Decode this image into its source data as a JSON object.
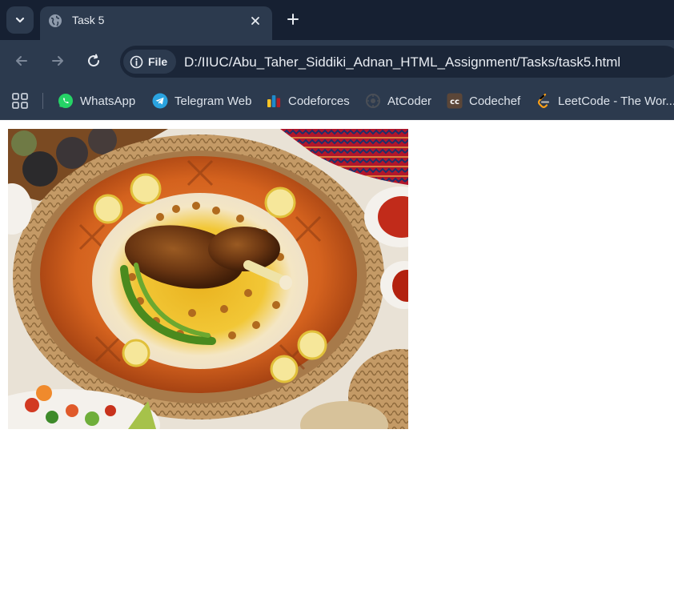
{
  "browser": {
    "tab": {
      "title": "Task 5",
      "favicon": "globe-icon"
    },
    "address_bar": {
      "chip_label": "File",
      "url": "D:/IIUC/Abu_Taher_Siddiki_Adnan_HTML_Assignment/Tasks/task5.html"
    },
    "bookmarks": [
      {
        "label": "WhatsApp",
        "icon": "whatsapp-icon",
        "color": "#25D366"
      },
      {
        "label": "Telegram Web",
        "icon": "telegram-icon",
        "color": "#2AA3E0"
      },
      {
        "label": "Codeforces",
        "icon": "codeforces-icon",
        "color": "#1F8ACB"
      },
      {
        "label": "AtCoder",
        "icon": "atcoder-icon",
        "color": "#3a3a3a"
      },
      {
        "label": "Codechef",
        "icon": "codechef-icon",
        "color": "#5B4638"
      },
      {
        "label": "LeetCode - The Wor...",
        "icon": "leetcode-icon",
        "color": "#FFA116"
      }
    ]
  },
  "page": {
    "image": {
      "subject": "food-photo"
    }
  },
  "colors": {
    "tabstrip": "#162032",
    "toolbar": "#2c3a4e",
    "omnibox": "#1b2638",
    "text": "#e8ecf2"
  }
}
